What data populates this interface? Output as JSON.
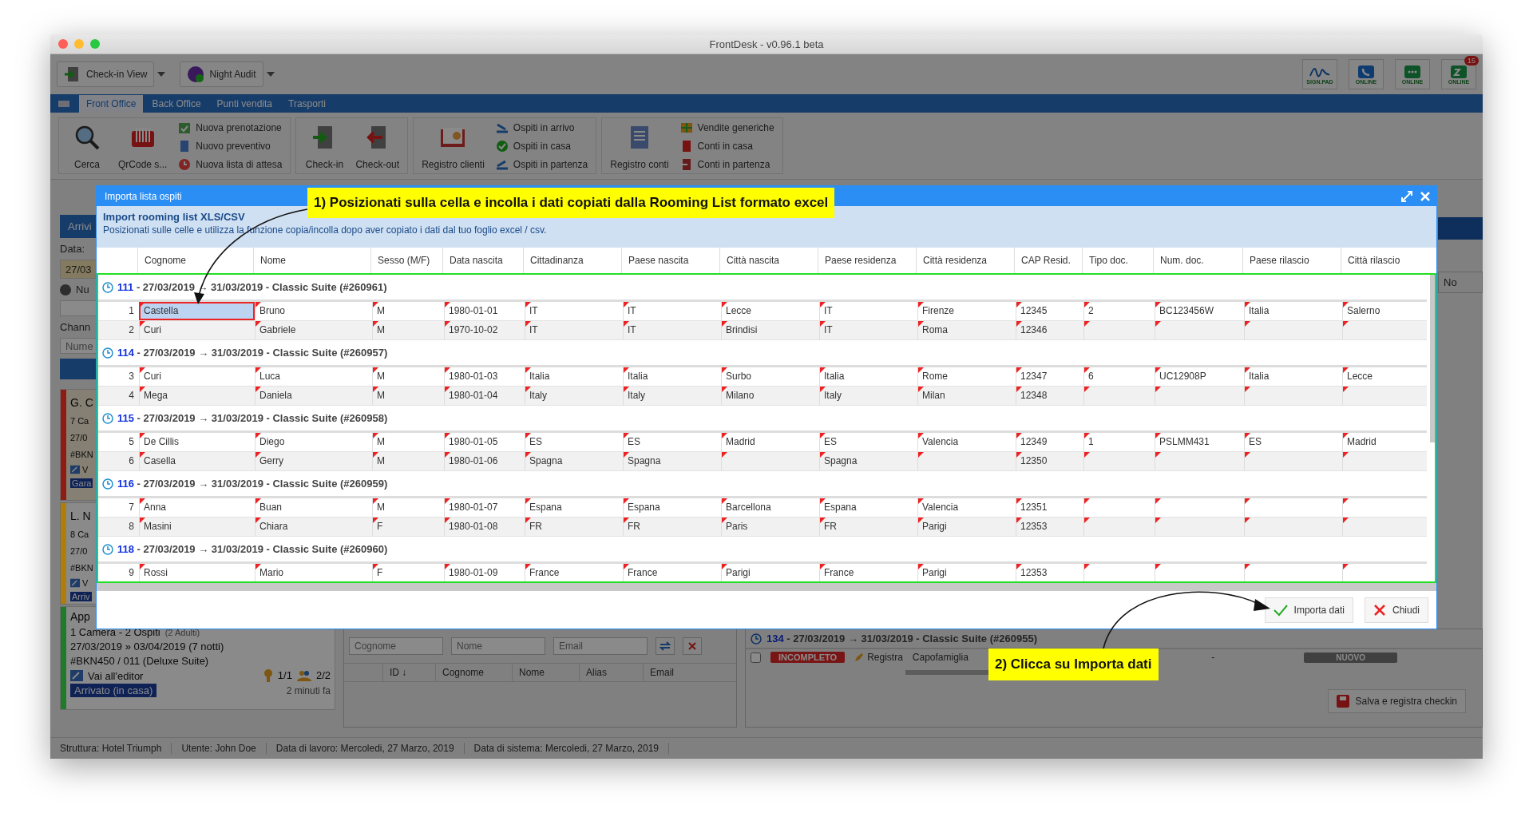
{
  "window": {
    "title": "FrontDesk - v0.96.1 beta"
  },
  "toolbar": {
    "buttons": [
      {
        "label": "Check-in View",
        "kind": "checkin"
      },
      {
        "label": "Night Audit",
        "kind": "night"
      }
    ],
    "status_icons": [
      {
        "label": "SIGN.PAD",
        "kind": "sign"
      },
      {
        "label": "ONLINE",
        "kind": "phone"
      },
      {
        "label": "ONLINE",
        "kind": "chat"
      },
      {
        "label": "ONLINE",
        "kind": "sleep",
        "badge": "15"
      }
    ]
  },
  "menu_tabs": [
    {
      "label": "Front Office",
      "selected": true
    },
    {
      "label": "Back Office",
      "selected": false
    },
    {
      "label": "Punti vendita",
      "selected": false
    },
    {
      "label": "Trasporti",
      "selected": false
    }
  ],
  "ribbon": {
    "groups": [
      {
        "large": [
          {
            "label": "Cerca",
            "kind": "search"
          },
          {
            "label": "QrCode s...",
            "kind": "qrcode"
          }
        ],
        "small": [
          {
            "label": "Nuova prenotazione",
            "kind": "booking"
          },
          {
            "label": "Nuovo preventivo",
            "kind": "quote"
          },
          {
            "label": "Nuova lista di attesa",
            "kind": "waiting"
          }
        ]
      },
      {
        "large": [
          {
            "label": "Check-in",
            "kind": "door-in"
          },
          {
            "label": "Check-out",
            "kind": "door-out"
          }
        ]
      },
      {
        "large": [
          {
            "label": "Registro clienti",
            "kind": "register"
          }
        ],
        "small": [
          {
            "label": "Ospiti in arrivo",
            "kind": "arrival"
          },
          {
            "label": "Ospiti in casa",
            "kind": "house"
          },
          {
            "label": "Ospiti in partenza",
            "kind": "departure"
          }
        ]
      },
      {
        "large": [
          {
            "label": "Registro conti",
            "kind": "accounts"
          }
        ],
        "small": [
          {
            "label": "Vendite generiche",
            "kind": "sales"
          },
          {
            "label": "Conti in casa",
            "kind": "bill"
          },
          {
            "label": "Conti in partenza",
            "kind": "bill-out"
          }
        ]
      }
    ]
  },
  "left_panel": {
    "tab": "Arrivi",
    "date_label": "Data:",
    "date_value": "27/03",
    "number_label": "Nu",
    "channel_label": "Chann",
    "number_placeholder": "Nume",
    "cards": [
      {
        "color": "#8e1c12",
        "tinted": true,
        "lines": [
          "G. C",
          "7 Ca",
          "27/0",
          "#BKN"
        ],
        "link": "V",
        "badge": "Gara"
      },
      {
        "color": "#b07d0c",
        "tinted": false,
        "lines": [
          "L. N",
          "8 Ca",
          "27/0",
          "#BKN"
        ],
        "link": "V",
        "badge": "Arriv"
      },
      {
        "color": "#1f7a2a",
        "tinted": false,
        "lines": [
          "App"
        ],
        "rooms": "1 Camera - 2 Ospiti",
        "adults": "(2 Adulti)",
        "dates": "27/03/2019 » 03/04/2019 (7 notti)",
        "booking": "#BKN450 / 011 (Deluxe Suite)",
        "link": "Vai all'editor",
        "keys": "1/1",
        "guests": "2/2",
        "badge": "Arrivato (in casa)",
        "time": "2 minuti fa"
      }
    ]
  },
  "guest_search": {
    "placeholders": [
      "Cognome",
      "Nome",
      "Email"
    ],
    "columns": [
      "ID ↓",
      "Cognome",
      "Nome",
      "Alias",
      "Email"
    ]
  },
  "room_panel": {
    "header_column": "No",
    "room": "134",
    "label": " - 27/03/2019 → 31/03/2019 - Classic Suite (#260955)",
    "row": {
      "checked": false,
      "status": "INCOMPLETO",
      "action": "Registra",
      "role": "Capofamiglia",
      "column_5": "-",
      "state": "NUOVO"
    },
    "save_button": "Salva e registra checkin"
  },
  "status_bar": [
    "Struttura: Hotel Triumph",
    "Utente: John Doe",
    "Data di lavoro: Mercoledi, 27 Marzo, 2019",
    "Data di sistema: Mercoledi, 27 Marzo, 2019"
  ],
  "dialog": {
    "title": "Importa lista ospiti",
    "heading": "Import rooming list XLS/CSV",
    "hint": "Posizionati sulle celle e utilizza la funzione copia/incolla dopo aver copiato i dati dal tuo foglio excel / csv.",
    "columns": [
      "Cognome",
      "Nome",
      "Sesso (M/F)",
      "Data nascita",
      "Cittadinanza",
      "Paese nascita",
      "Città nascita",
      "Paese residenza",
      "Città residenza",
      "CAP Resid.",
      "Tipo doc.",
      "Num. doc.",
      "Paese rilascio",
      "Città rilascio"
    ],
    "groups": [
      {
        "room": "111",
        "label": " - 27/03/2019 → 31/03/2019 - Classic Suite (#260961)",
        "rows": [
          {
            "number": "1",
            "cells": [
              {
                "text": "Castella",
                "selected": true
              },
              {
                "text": "Bruno",
                "selected": false
              },
              {
                "text": "M",
                "selected": false
              },
              {
                "text": "1980-01-01",
                "selected": false
              },
              {
                "text": "IT",
                "selected": false
              },
              {
                "text": "IT",
                "selected": false
              },
              {
                "text": "Lecce",
                "selected": false
              },
              {
                "text": "IT",
                "selected": false
              },
              {
                "text": "Firenze",
                "selected": false
              },
              {
                "text": "12345",
                "selected": false
              },
              {
                "text": "2",
                "selected": false
              },
              {
                "text": "BC123456W",
                "selected": false
              },
              {
                "text": "Italia",
                "selected": false
              },
              {
                "text": "Salerno",
                "selected": false
              }
            ]
          },
          {
            "number": "2",
            "cells": [
              {
                "text": "Curi",
                "selected": false
              },
              {
                "text": "Gabriele",
                "selected": false
              },
              {
                "text": "M",
                "selected": false
              },
              {
                "text": "1970-10-02",
                "selected": false
              },
              {
                "text": "IT",
                "selected": false
              },
              {
                "text": "IT",
                "selected": false
              },
              {
                "text": "Brindisi",
                "selected": false
              },
              {
                "text": "IT",
                "selected": false
              },
              {
                "text": "Roma",
                "selected": false
              },
              {
                "text": "12346",
                "selected": false
              },
              {
                "selected": false
              },
              {
                "selected": false
              },
              {
                "selected": false
              },
              {
                "selected": false
              }
            ]
          }
        ]
      },
      {
        "room": "114",
        "label": " - 27/03/2019 → 31/03/2019 - Classic Suite (#260957)",
        "rows": [
          {
            "number": "3",
            "cells": [
              {
                "text": "Curi",
                "selected": false
              },
              {
                "text": "Luca",
                "selected": false
              },
              {
                "text": "M",
                "selected": false
              },
              {
                "text": "1980-01-03",
                "selected": false
              },
              {
                "text": "Italia",
                "selected": false
              },
              {
                "text": "Italia",
                "selected": false
              },
              {
                "text": "Surbo",
                "selected": false
              },
              {
                "text": "Italia",
                "selected": false
              },
              {
                "text": "Rome",
                "selected": false
              },
              {
                "text": "12347",
                "selected": false
              },
              {
                "text": "6",
                "selected": false
              },
              {
                "text": "UC12908P",
                "selected": false
              },
              {
                "text": "Italia",
                "selected": false
              },
              {
                "text": "Lecce",
                "selected": false
              }
            ]
          },
          {
            "number": "4",
            "cells": [
              {
                "text": "Mega",
                "selected": false
              },
              {
                "text": "Daniela",
                "selected": false
              },
              {
                "text": "M",
                "selected": false
              },
              {
                "text": "1980-01-04",
                "selected": false
              },
              {
                "text": "Italy",
                "selected": false
              },
              {
                "text": "Italy",
                "selected": false
              },
              {
                "text": "Milano",
                "selected": false
              },
              {
                "text": "Italy",
                "selected": false
              },
              {
                "text": "Milan",
                "selected": false
              },
              {
                "text": "12348",
                "selected": false
              },
              {
                "selected": false
              },
              {
                "selected": false
              },
              {
                "selected": false
              },
              {
                "selected": false
              }
            ]
          }
        ]
      },
      {
        "room": "115",
        "label": " - 27/03/2019 → 31/03/2019 - Classic Suite (#260958)",
        "rows": [
          {
            "number": "5",
            "cells": [
              {
                "text": "De Cillis",
                "selected": false
              },
              {
                "text": "Diego",
                "selected": false
              },
              {
                "text": "M",
                "selected": false
              },
              {
                "text": "1980-01-05",
                "selected": false
              },
              {
                "text": "ES",
                "selected": false
              },
              {
                "text": "ES",
                "selected": false
              },
              {
                "text": "Madrid",
                "selected": false
              },
              {
                "text": "ES",
                "selected": false
              },
              {
                "text": "Valencia",
                "selected": false
              },
              {
                "text": "12349",
                "selected": false
              },
              {
                "text": "1",
                "selected": false
              },
              {
                "text": "PSLMM431",
                "selected": false
              },
              {
                "text": "ES",
                "selected": false
              },
              {
                "text": "Madrid",
                "selected": false
              }
            ]
          },
          {
            "number": "6",
            "cells": [
              {
                "text": "Casella",
                "selected": false
              },
              {
                "text": "Gerry",
                "selected": false
              },
              {
                "text": "M",
                "selected": false
              },
              {
                "text": "1980-01-06",
                "selected": false
              },
              {
                "text": "Spagna",
                "selected": false
              },
              {
                "text": "Spagna",
                "selected": false
              },
              {
                "selected": false
              },
              {
                "text": "Spagna",
                "selected": false
              },
              {
                "selected": false
              },
              {
                "text": "12350",
                "selected": false
              },
              {
                "selected": false
              },
              {
                "selected": false
              },
              {
                "selected": false
              },
              {
                "selected": false
              }
            ]
          }
        ]
      },
      {
        "room": "116",
        "label": " - 27/03/2019 → 31/03/2019 - Classic Suite (#260959)",
        "rows": [
          {
            "number": "7",
            "cells": [
              {
                "text": "Anna",
                "selected": false
              },
              {
                "text": "Buan",
                "selected": false
              },
              {
                "text": "M",
                "selected": false
              },
              {
                "text": "1980-01-07",
                "selected": false
              },
              {
                "text": "Espana",
                "selected": false
              },
              {
                "text": "Espana",
                "selected": false
              },
              {
                "text": "Barcellona",
                "selected": false
              },
              {
                "text": "Espana",
                "selected": false
              },
              {
                "text": "Valencia",
                "selected": false
              },
              {
                "text": "12351",
                "selected": false
              },
              {
                "selected": false
              },
              {
                "selected": false
              },
              {
                "selected": false
              },
              {
                "selected": false
              }
            ]
          },
          {
            "number": "8",
            "cells": [
              {
                "text": "Masini",
                "selected": false
              },
              {
                "text": "Chiara",
                "selected": false
              },
              {
                "text": "F",
                "selected": false
              },
              {
                "text": "1980-01-08",
                "selected": false
              },
              {
                "text": "FR",
                "selected": false
              },
              {
                "text": "FR",
                "selected": false
              },
              {
                "text": "Paris",
                "selected": false
              },
              {
                "text": "FR",
                "selected": false
              },
              {
                "text": "Parigi",
                "selected": false
              },
              {
                "text": "12353",
                "selected": false
              },
              {
                "selected": false
              },
              {
                "selected": false
              },
              {
                "selected": false
              },
              {
                "selected": false
              }
            ]
          }
        ]
      },
      {
        "room": "118",
        "label": " - 27/03/2019 → 31/03/2019 - Classic Suite (#260960)",
        "rows": [
          {
            "number": "9",
            "cells": [
              {
                "text": "Rossi",
                "selected": false
              },
              {
                "text": "Mario",
                "selected": false
              },
              {
                "text": "F",
                "selected": false
              },
              {
                "text": "1980-01-09",
                "selected": false
              },
              {
                "text": "France",
                "selected": false
              },
              {
                "text": "France",
                "selected": false
              },
              {
                "text": "Parigi",
                "selected": false
              },
              {
                "text": "France",
                "selected": false
              },
              {
                "text": "Parigi",
                "selected": false
              },
              {
                "text": "12353",
                "selected": false
              },
              {
                "selected": false
              },
              {
                "selected": false
              },
              {
                "selected": false
              },
              {
                "selected": false
              }
            ]
          }
        ]
      }
    ],
    "buttons": [
      {
        "label": "Importa dati",
        "kind": "confirm"
      },
      {
        "label": "Chiudi",
        "kind": "cancel"
      }
    ]
  },
  "annotations": [
    {
      "text": "1) Posizionati sulla cella e incolla i dati copiati dalla Rooming List formato excel",
      "kind": "top"
    },
    {
      "text": "2) Clicca su Importa dati",
      "kind": "bottom"
    }
  ]
}
